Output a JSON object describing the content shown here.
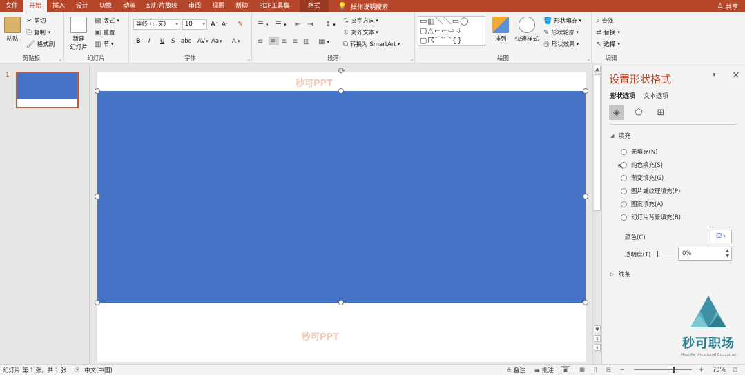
{
  "menubar": {
    "tabs": [
      "文件",
      "开始",
      "插入",
      "设计",
      "切换",
      "动画",
      "幻灯片放映",
      "审阅",
      "视图",
      "帮助",
      "PDF工具集"
    ],
    "active_tab": "开始",
    "format_tab": "格式",
    "tell_me": "操作说明搜索",
    "share": "共享"
  },
  "ribbon": {
    "clipboard": {
      "paste": "粘贴",
      "cut": "剪切",
      "copy": "复制",
      "format_painter": "格式刷",
      "label": "剪贴板"
    },
    "slides": {
      "new_slide": "新建",
      "new_slide2": "幻灯片",
      "layout": "版式",
      "reset": "重置",
      "section": "节",
      "label": "幻灯片"
    },
    "font": {
      "font_name": "等线 (正文)",
      "font_size": "18",
      "bold": "B",
      "italic": "I",
      "underline": "U",
      "shadow": "S",
      "strike": "abc",
      "spacing": "AV",
      "case": "Aa",
      "color": "A",
      "grow": "A",
      "shrink": "A",
      "label": "字体"
    },
    "paragraph": {
      "text_direction": "文字方向",
      "align_text": "对齐文本",
      "smartart": "转换为 SmartArt",
      "label": "段落"
    },
    "drawing": {
      "arrange": "排列",
      "quick_styles": "快速样式",
      "shape_fill": "形状填充",
      "shape_outline": "形状轮廓",
      "shape_effects": "形状效果",
      "label": "绘图"
    },
    "editing": {
      "find": "查找",
      "replace": "替换",
      "select": "选择",
      "label": "编辑"
    }
  },
  "thumbnails": {
    "slide_number": "1"
  },
  "slide": {
    "watermark": "秒可PPT"
  },
  "format_pane": {
    "title": "设置形状格式",
    "tabs": [
      "形状选项",
      "文本选项"
    ],
    "fill_section": "填充",
    "fill_options": [
      "无填充(N)",
      "纯色填充(S)",
      "渐变填充(G)",
      "图片或纹理填充(P)",
      "图案填充(A)",
      "幻灯片背景填充(B)"
    ],
    "color_label": "颜色(C)",
    "transparency_label": "透明度(T)",
    "transparency_value": "0%",
    "line_section": "线条"
  },
  "logo": {
    "name": "秒可职场",
    "english": "Miao Ke Vocational Education"
  },
  "status": {
    "slide_info": "幻灯片 第 1 张，共 1 张",
    "language": "中文(中国)",
    "notes": "备注",
    "comments": "批注",
    "zoom": "73%",
    "zoom_fraction": 0.73
  },
  "colors": {
    "accent": "#b7472a",
    "shape_fill": "#4472c4",
    "pane_title": "#b7472a"
  }
}
